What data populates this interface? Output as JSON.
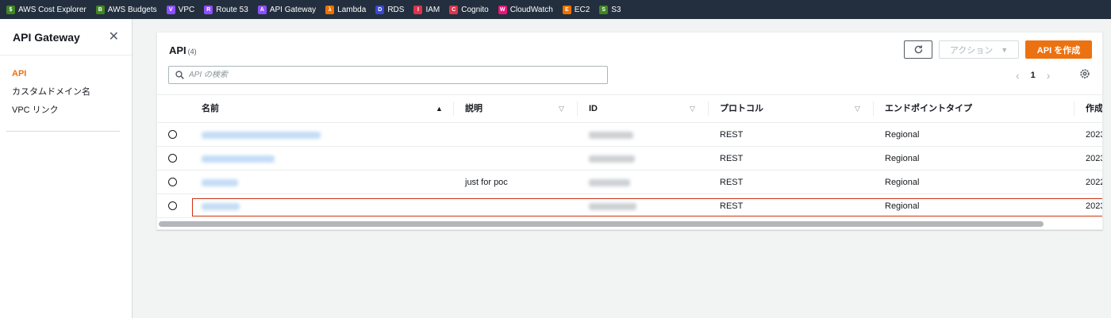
{
  "favorites": [
    {
      "label": "AWS Cost Explorer",
      "color": "#3f8624",
      "icon": "cost-explorer-icon"
    },
    {
      "label": "AWS Budgets",
      "color": "#3f8624",
      "icon": "budgets-icon"
    },
    {
      "label": "VPC",
      "color": "#8c4fff",
      "icon": "vpc-icon"
    },
    {
      "label": "Route 53",
      "color": "#8c4fff",
      "icon": "route53-icon"
    },
    {
      "label": "API Gateway",
      "color": "#8c4fff",
      "icon": "api-gateway-icon"
    },
    {
      "label": "Lambda",
      "color": "#ed7100",
      "icon": "lambda-icon"
    },
    {
      "label": "RDS",
      "color": "#3b48cc",
      "icon": "rds-icon"
    },
    {
      "label": "IAM",
      "color": "#dd344c",
      "icon": "iam-icon"
    },
    {
      "label": "Cognito",
      "color": "#dd344c",
      "icon": "cognito-icon"
    },
    {
      "label": "CloudWatch",
      "color": "#e7157b",
      "icon": "cloudwatch-icon"
    },
    {
      "label": "EC2",
      "color": "#ed7100",
      "icon": "ec2-icon"
    },
    {
      "label": "S3",
      "color": "#3f8624",
      "icon": "s3-icon"
    }
  ],
  "sidebar": {
    "title": "API Gateway",
    "items": [
      {
        "label": "API",
        "active": true
      },
      {
        "label": "カスタムドメイン名",
        "active": false
      },
      {
        "label": "VPC リンク",
        "active": false
      }
    ]
  },
  "panel": {
    "title": "API",
    "count": "(4)",
    "action_label": "アクション",
    "create_label": "API を作成",
    "search_placeholder": "API の検索",
    "page_number": "1"
  },
  "table": {
    "columns": [
      "名前",
      "説明",
      "ID",
      "プロトコル",
      "エンドポイントタイプ",
      "作成"
    ],
    "rows": [
      {
        "description": "",
        "protocol": "REST",
        "endpoint_type": "Regional",
        "created": "2023"
      },
      {
        "description": "",
        "protocol": "REST",
        "endpoint_type": "Regional",
        "created": "2023"
      },
      {
        "description": "just for poc",
        "protocol": "REST",
        "endpoint_type": "Regional",
        "created": "2022"
      },
      {
        "description": "",
        "protocol": "REST",
        "endpoint_type": "Regional",
        "created": "2023"
      }
    ]
  },
  "colors": {
    "accent": "#ec7211",
    "nav_bg": "#232f3e",
    "highlight": "#d13212"
  }
}
